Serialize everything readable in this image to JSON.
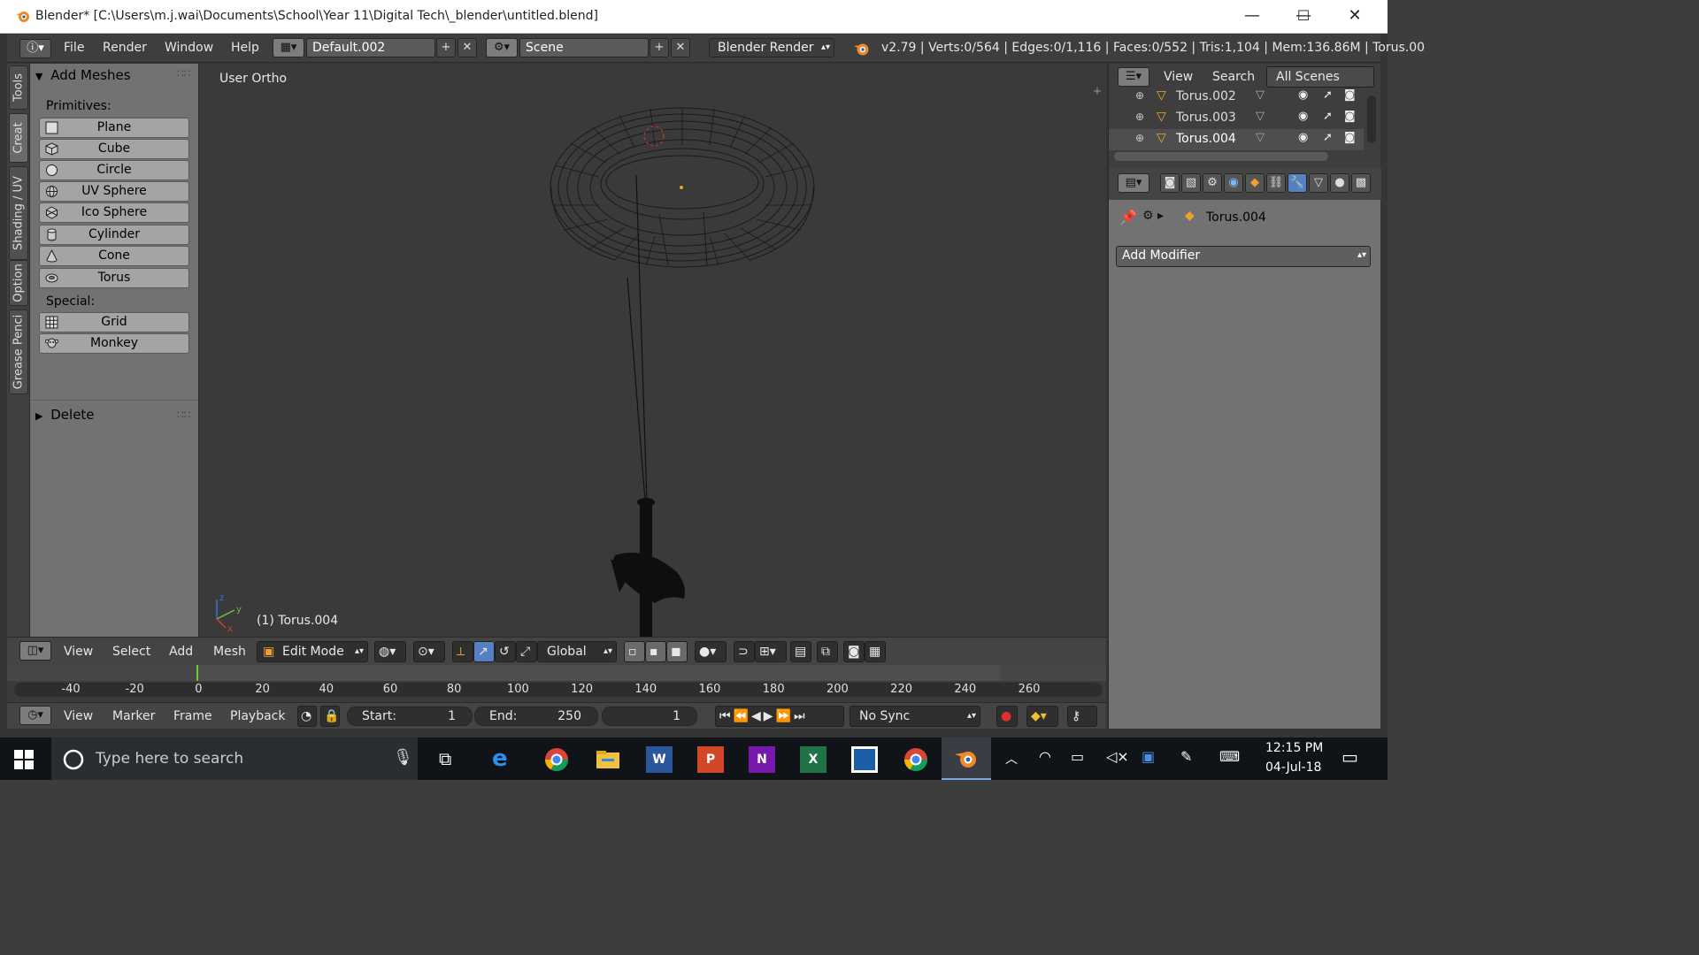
{
  "window": {
    "title": "Blender* [C:\\Users\\m.j.wai\\Documents\\School\\Year 11\\Digital Tech\\_blender\\untitled.blend]",
    "minimize": "—",
    "maximize": "☐",
    "close": "✕"
  },
  "info_header": {
    "menus": [
      "File",
      "Render",
      "Window",
      "Help"
    ],
    "layout": "Default.002",
    "scene": "Scene",
    "engine": "Blender Render",
    "stats": "v2.79 | Verts:0/564 | Edges:0/1,116 | Faces:0/552 | Tris:1,104 | Mem:136.86M | Torus.00"
  },
  "tool_tabs": [
    "Tools",
    "Creat",
    "Shading / UV",
    "Option",
    "Grease Penci"
  ],
  "tool_shelf": {
    "panel_title": "Add Meshes",
    "primitives_label": "Primitives:",
    "primitives": [
      {
        "label": "Plane",
        "icon": "plane-icon"
      },
      {
        "label": "Cube",
        "icon": "cube-icon"
      },
      {
        "label": "Circle",
        "icon": "circle-icon"
      },
      {
        "label": "UV Sphere",
        "icon": "uv-sphere-icon"
      },
      {
        "label": "Ico Sphere",
        "icon": "ico-sphere-icon"
      },
      {
        "label": "Cylinder",
        "icon": "cylinder-icon"
      },
      {
        "label": "Cone",
        "icon": "cone-icon"
      },
      {
        "label": "Torus",
        "icon": "torus-icon"
      }
    ],
    "special_label": "Special:",
    "special": [
      {
        "label": "Grid",
        "icon": "grid-icon"
      },
      {
        "label": "Monkey",
        "icon": "monkey-icon"
      }
    ],
    "delete_panel": "Delete"
  },
  "viewport": {
    "view_label": "User Ortho",
    "object_label": "(1) Torus.004"
  },
  "view3d_header": {
    "menus": [
      "View",
      "Select",
      "Add",
      "Mesh"
    ],
    "mode": "Edit Mode",
    "orientation": "Global"
  },
  "timeline": {
    "ticks": [
      "-40",
      "-20",
      "0",
      "20",
      "40",
      "60",
      "80",
      "100",
      "120",
      "140",
      "160",
      "180",
      "200",
      "220",
      "240",
      "260"
    ],
    "menus": [
      "View",
      "Marker",
      "Frame",
      "Playback"
    ],
    "start_label": "Start:",
    "start_value": "1",
    "end_label": "End:",
    "end_value": "250",
    "current_frame": "1",
    "sync": "No Sync"
  },
  "outliner": {
    "menus": [
      "View",
      "Search"
    ],
    "filter": "All Scenes",
    "items": [
      "Torus.002",
      "Torus.003",
      "Torus.004"
    ]
  },
  "properties": {
    "object": "Torus.004",
    "add_modifier": "Add Modifier"
  },
  "taskbar": {
    "search_placeholder": "Type here to search",
    "time": "12:15 PM",
    "date": "04-Jul-18"
  },
  "colors": {
    "blender_orange": "#f0882a",
    "active_blue": "#5680c2",
    "selected_row": "#6a6a6a"
  }
}
